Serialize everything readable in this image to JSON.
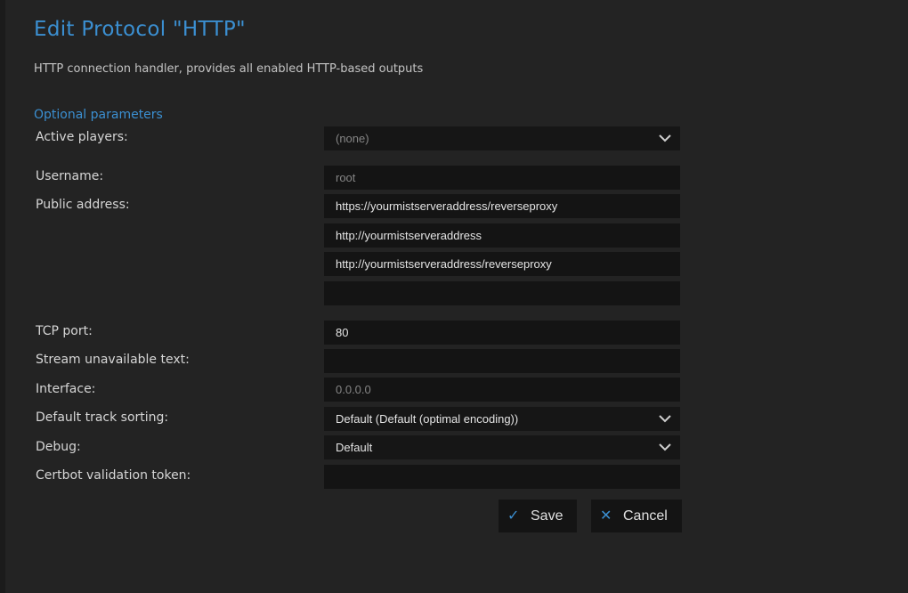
{
  "header": {
    "title": "Edit Protocol \"HTTP\"",
    "description": "HTTP connection handler, provides all enabled HTTP-based outputs"
  },
  "section": {
    "optional_label": "Optional parameters"
  },
  "fields": {
    "active_players": {
      "label": "Active players:",
      "value": "(none)"
    },
    "username": {
      "label": "Username:",
      "placeholder": "root"
    },
    "public_address": {
      "label": "Public address:",
      "values": [
        "https://yourmistserveraddress/reverseproxy",
        "http://yourmistserveraddress",
        "http://yourmistserveraddress/reverseproxy",
        ""
      ]
    },
    "tcp_port": {
      "label": "TCP port:",
      "value": "80"
    },
    "stream_unavailable_text": {
      "label": "Stream unavailable text:",
      "value": ""
    },
    "interface": {
      "label": "Interface:",
      "placeholder": "0.0.0.0"
    },
    "default_track_sorting": {
      "label": "Default track sorting:",
      "value": "Default (Default (optimal encoding))"
    },
    "debug": {
      "label": "Debug:",
      "value": "Default"
    },
    "certbot_validation_token": {
      "label": "Certbot validation token:",
      "value": ""
    }
  },
  "buttons": {
    "save": {
      "label": "Save",
      "icon": "check-icon"
    },
    "cancel": {
      "label": "Cancel",
      "icon": "close-icon"
    }
  },
  "colors": {
    "accent": "#3b8fd1",
    "background": "#232323",
    "field_bg": "#141414"
  }
}
